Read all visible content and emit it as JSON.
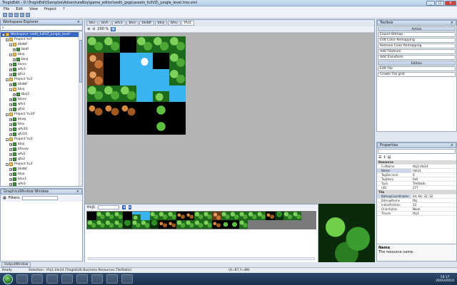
{
  "window": {
    "title": "TrogloEdit - D:\\TrogloEdit\\Samples\\AdventureBoy\\game_editor\\sedit_gsgs\\assets_fullVZ\\_jungle_level.trov.xml"
  },
  "menu": [
    "File",
    "Edit",
    "View",
    "Project",
    "?"
  ],
  "workspace": {
    "title": "Workspace Explorer",
    "filter": "",
    "tree": [
      {
        "label": "Workspace 'sedit_fullVZ_jungle_level'",
        "depth": 0,
        "kind": "folder",
        "selected": true
      },
      {
        "label": "Project 'tvf'",
        "depth": 1,
        "kind": "folder"
      },
      {
        "label": "bkdbf",
        "depth": 2,
        "kind": "folder"
      },
      {
        "label": "bkdf",
        "depth": 3,
        "kind": "bmp"
      },
      {
        "label": "bkvj",
        "depth": 2,
        "kind": "folder"
      },
      {
        "label": "bkvj",
        "depth": 3,
        "kind": "bmp"
      },
      {
        "label": "blvvv",
        "depth": 2,
        "kind": "bmp"
      },
      {
        "label": "wfv3",
        "depth": 2,
        "kind": "bmp"
      },
      {
        "label": "gfv3",
        "depth": 2,
        "kind": "bmp"
      },
      {
        "label": "Project 'tv1'",
        "depth": 1,
        "kind": "folder"
      },
      {
        "label": "bkdbf",
        "depth": 2,
        "kind": "bmp"
      },
      {
        "label": "bkvj",
        "depth": 2,
        "kind": "folder"
      },
      {
        "label": "tbvj1",
        "depth": 3,
        "kind": "bmp"
      },
      {
        "label": "blvvv",
        "depth": 2,
        "kind": "bmp"
      },
      {
        "label": "wfv1",
        "depth": 2,
        "kind": "bmp"
      },
      {
        "label": "gfv1",
        "depth": 2,
        "kind": "bmp"
      },
      {
        "label": "Project 'tv10'",
        "depth": 1,
        "kind": "folder"
      },
      {
        "label": "bkvg",
        "depth": 2,
        "kind": "bmp"
      },
      {
        "label": "blvv",
        "depth": 2,
        "kind": "bmp"
      },
      {
        "label": "wfv10",
        "depth": 2,
        "kind": "bmp"
      },
      {
        "label": "gfv10",
        "depth": 2,
        "kind": "bmp"
      },
      {
        "label": "Project 'tv2'",
        "depth": 1,
        "kind": "folder"
      },
      {
        "label": "bkvj",
        "depth": 2,
        "kind": "bmp"
      },
      {
        "label": "bfvvvv",
        "depth": 2,
        "kind": "bmp"
      },
      {
        "label": "wfv2",
        "depth": 2,
        "kind": "bmp"
      },
      {
        "label": "gfv2",
        "depth": 2,
        "kind": "bmp"
      },
      {
        "label": "Project 'tv3'",
        "depth": 1,
        "kind": "folder"
      },
      {
        "label": "bkdbf",
        "depth": 2,
        "kind": "bmp"
      },
      {
        "label": "bkvj",
        "depth": 2,
        "kind": "bmp"
      },
      {
        "label": "blvv1",
        "depth": 2,
        "kind": "bmp"
      },
      {
        "label": "wfv3",
        "depth": 2,
        "kind": "bmp"
      },
      {
        "label": "gfv3",
        "depth": 2,
        "kind": "bmp"
      },
      {
        "label": "Project 'tv4'",
        "depth": 1,
        "kind": "folder"
      },
      {
        "label": "bkdbf",
        "depth": 2,
        "kind": "bmp"
      },
      {
        "label": "bkvvs",
        "depth": 2,
        "kind": "bmp"
      },
      {
        "label": "wfv4",
        "depth": 2,
        "kind": "bmp"
      }
    ]
  },
  "graphics_window": {
    "title": "GraphicsWindow Window",
    "filter_label": "Filters:"
  },
  "editor": {
    "tabs": [
      "bkv",
      "blvh",
      "wfv3",
      "blvv",
      "bkdbf",
      "bkvj",
      "bfvv",
      "tfvj1"
    ],
    "active_tab": "tfvj1",
    "zoom": "200 %",
    "tilemap": [
      [
        "grass",
        "grass",
        "black",
        "grass",
        "grass",
        "grass"
      ],
      [
        "rock",
        "black",
        "sky",
        "cloud",
        "black",
        "grass"
      ],
      [
        "rock",
        "black",
        "sky",
        "sky",
        "sky",
        "grass"
      ],
      [
        "grass",
        "grass",
        "grass",
        "sky",
        "grasssky",
        "sky"
      ],
      [
        "dirt",
        "dirt",
        "dirt",
        "black",
        "bush",
        "black"
      ],
      [
        "black",
        "black",
        "black",
        "black",
        "bush",
        "black"
      ]
    ]
  },
  "tileset": {
    "name": "tfvj1",
    "row1": [
      "black",
      "grass",
      "grass",
      "grass",
      "black",
      "grasssky",
      "sky",
      "grass",
      "grass",
      "grass",
      "dirt",
      "dirt",
      "grass",
      "grass",
      "rock",
      "grass",
      "grass",
      "grass",
      "grass",
      "grass",
      "dirt",
      "darkgreen",
      "grass",
      "grass"
    ],
    "row2": [
      "grass",
      "grass",
      "grass",
      "grass",
      "darkgreen",
      "grass",
      "grass",
      "darkgreen",
      "dirt",
      "dirt",
      "grass",
      "grass",
      "grass",
      "grass",
      "dirt",
      "bush",
      "bush",
      "grass"
    ]
  },
  "toolbox": {
    "title": "Toolbox",
    "sections": [
      {
        "label": "Action",
        "buttons": [
          "Export Bitmap",
          "Edit Color Remapping",
          "Remove Color Remapping",
          "Add TileAnim",
          "Add Transform"
        ]
      },
      {
        "label": "Edition",
        "buttons": [
          "Edit Tile",
          "Create Tile grid"
        ]
      }
    ]
  },
  "properties": {
    "title": "Properties",
    "rows": [
      {
        "k": "Resource",
        "v": "",
        "cat": true
      },
      {
        "k": "FullName",
        "v": "tfvj1.tile14"
      },
      {
        "k": "Name",
        "v": "tile14",
        "hl": true
      },
      {
        "k": "TagDecimal",
        "v": "0"
      },
      {
        "k": "TagHexa",
        "v": "0x0"
      },
      {
        "k": "Type",
        "v": "TileStatic"
      },
      {
        "k": "UID",
        "v": "177"
      },
      {
        "k": "Tile",
        "v": "",
        "cat": true
      },
      {
        "k": "BitmapCoordinates",
        "v": "64; 64; 32; 32",
        "hl": true
      },
      {
        "k": "BitmapName",
        "v": "tfvj"
      },
      {
        "k": "IndexPosition",
        "v": "13"
      },
      {
        "k": "Orientation",
        "v": "None"
      },
      {
        "k": "Tileset",
        "v": "tfvj1"
      }
    ],
    "help_title": "Name",
    "help_text": "The resource name."
  },
  "output": {
    "title": "OutputWindow"
  },
  "status": {
    "ready": "Ready",
    "selection": "Selection : tfvj1.tile14 (TrogloEdit.Business.Resources.TileStatic)",
    "coords": "(X=87,Y=88)"
  },
  "clock": {
    "time": "19:17",
    "date": "20/03/2010"
  },
  "colors": {
    "accent": "#3668c4",
    "titlebar": "#b4cbe6",
    "taskbar": "#18304d"
  }
}
